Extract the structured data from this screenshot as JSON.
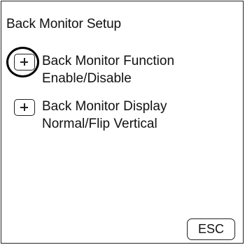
{
  "screen": {
    "title": "Back Monitor Setup"
  },
  "menu": {
    "items": [
      {
        "line1": "Back Monitor Function",
        "line2": "Enable/Disable",
        "button_icon": "plus-icon",
        "highlighted": true
      },
      {
        "line1": "Back Monitor Display",
        "line2": "Normal/Flip Vertical",
        "button_icon": "plus-icon",
        "highlighted": false
      }
    ]
  },
  "footer": {
    "esc_label": "ESC"
  }
}
